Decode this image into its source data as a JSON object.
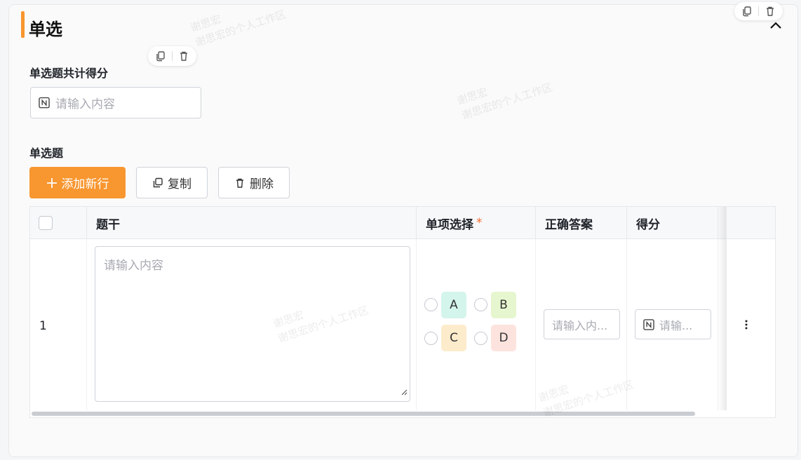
{
  "section": {
    "title": "单选"
  },
  "total_score": {
    "label": "单选题共计得分",
    "placeholder": "请输入内容"
  },
  "questions": {
    "label": "单选题",
    "add_button": "添加新行",
    "copy_button": "复制",
    "delete_button": "删除"
  },
  "table": {
    "columns": [
      "题干",
      "单项选择",
      "正确答案",
      "得分"
    ],
    "required_mark": "*",
    "rows": [
      {
        "index": "1",
        "stem_placeholder": "请输入内容",
        "options": [
          "A",
          "B",
          "C",
          "D"
        ],
        "answer_placeholder": "请输入内...",
        "score_placeholder": "请输..."
      }
    ]
  },
  "watermark": {
    "name": "谢思宏",
    "text": "谢思宏的个人工作区"
  },
  "colors": {
    "accent": "#f8962f",
    "option_a": "#d4f5ec",
    "option_b": "#e6f6cf",
    "option_c": "#fdeccb",
    "option_d": "#fde3de"
  },
  "icons": [
    "copy-icon",
    "trash-icon",
    "chevron-up-icon",
    "plus-icon",
    "number-icon",
    "more-vertical-icon"
  ]
}
